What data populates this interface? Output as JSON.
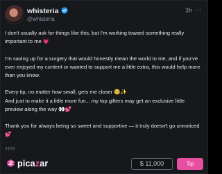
{
  "post": {
    "author_name": "whisteria",
    "author_handle": "@whisteria",
    "timestamp": "3h",
    "more_glyph": "···",
    "paragraphs": [
      "I don't usually ask for things like this, but I'm working toward something really important to me 💗",
      "I'm saving up for a surgery that would honestly mean the world to me, and if you've ever enjoyed my content or wanted to support me a little extra, this would help more than you know.",
      "Every tip, no matter how small, gets me closer 🥺✨",
      "And just to make it a little more fun... my top gifters may get an exclusive little preview along the way 👀💕",
      "Thank you for always being so sweet and supportive — it truly doesn't go unnoticed 💕"
    ],
    "trailing_text": "????"
  },
  "footer": {
    "brand_prefix": "pica",
    "brand_z": "z",
    "brand_suffix": "ar",
    "tip_amount": "$ 11,000",
    "tip_button_label": "Tip"
  },
  "colors": {
    "accent": "#e84ea0",
    "verified": "#1d9bf0",
    "background": "#16181c"
  },
  "icons": {
    "verified": "verified-badge-icon",
    "more": "more-options-icon",
    "logo": "picazar-logo-icon"
  }
}
